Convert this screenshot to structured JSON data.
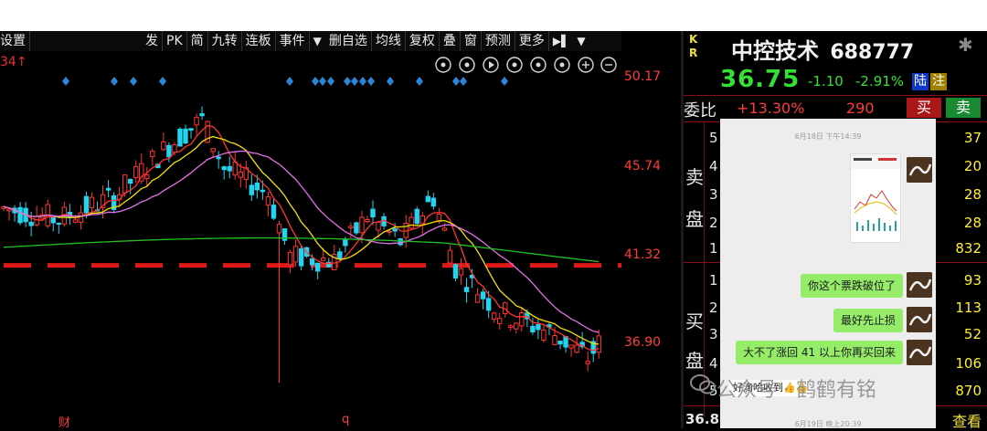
{
  "toolbar": {
    "items": [
      "设置",
      "发",
      "PK",
      "简",
      "九转",
      "连板",
      "事件",
      "删自选",
      "均线",
      "复权",
      "叠",
      "窗",
      "预测",
      "更多"
    ],
    "dropdown": "▼",
    "pin": "▶▌"
  },
  "chart": {
    "price_labels": [
      "50.17",
      "45.74",
      "41.32",
      "36.90"
    ],
    "bottom_labels": [
      "财",
      "q"
    ],
    "edge_label": "34↑",
    "tool_icons": [
      "eye-icon",
      "hand-icon",
      "play-icon",
      "undo-icon",
      "cut-icon",
      "lock-icon",
      "zoom-in-icon",
      "zoom-out-icon"
    ]
  },
  "chart_data": {
    "type": "candlestick",
    "ylim": [
      35.5,
      51.5
    ],
    "reference_line": 41.32,
    "ma_colors": {
      "ma5": "#ff3535",
      "ma10": "#f2e200",
      "ma20": "#e070e8",
      "ma60": "#22c022"
    }
  },
  "quote": {
    "market_tag": [
      "K",
      "R"
    ],
    "name": "中控技术",
    "code": "688777",
    "price": "36.75",
    "change": "-1.10",
    "change_pct": "-2.91%",
    "tag1": "陆",
    "tag2": "注",
    "weibi_label": "委比",
    "weibi_value": "+13.30%",
    "weibi_diff": "290",
    "buy_label": "买",
    "sell_label": "卖",
    "sell_side": [
      "卖",
      "盘"
    ],
    "buy_side": [
      "买",
      "盘"
    ],
    "sell_levels": [
      {
        "level": "5",
        "vol": "37"
      },
      {
        "level": "4",
        "vol": "20"
      },
      {
        "level": "3",
        "vol": "28"
      },
      {
        "level": "2",
        "vol": "28"
      },
      {
        "level": "1",
        "vol": "832"
      }
    ],
    "buy_levels": [
      {
        "level": "1",
        "vol": "93"
      },
      {
        "level": "2",
        "vol": "113"
      },
      {
        "level": "3",
        "vol": "52"
      },
      {
        "level": "4",
        "vol": "106"
      },
      {
        "level": "5",
        "vol": "870"
      }
    ],
    "bottom_price": "36.8",
    "bottom_link": "查看"
  },
  "chat": {
    "time1": "6月18日 下午14:39",
    "messages": [
      "你这个票跌破位了",
      "最好先止损",
      "大不了涨回 41 以上你再买回来"
    ],
    "reply": "好滴哈收到👍👍",
    "time2": "6月19日 晚上20:39"
  },
  "watermark": "公众号 · 鹤鹤有铭"
}
